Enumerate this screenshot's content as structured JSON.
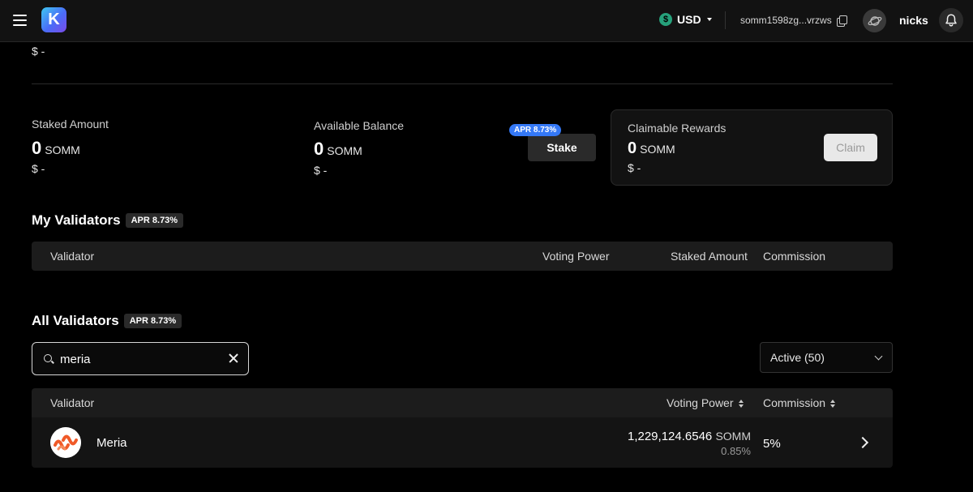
{
  "header": {
    "logo_letter": "K",
    "currency_symbol": "$",
    "currency": "USD",
    "wallet_address": "somm1598zg...vrzws",
    "username": "nicks"
  },
  "summary": {
    "top_usd": "$ -"
  },
  "staked": {
    "label": "Staked Amount",
    "amount": "0",
    "unit": "SOMM",
    "usd": "$ -"
  },
  "available": {
    "label": "Available Balance",
    "amount": "0",
    "unit": "SOMM",
    "usd": "$ -"
  },
  "stake_button": {
    "label": "Stake",
    "apr_badge": "APR 8.73%"
  },
  "rewards": {
    "label": "Claimable Rewards",
    "amount": "0",
    "unit": "SOMM",
    "usd": "$ -",
    "claim_label": "Claim"
  },
  "my_validators": {
    "title": "My Validators",
    "apr": "APR 8.73%",
    "columns": [
      "Validator",
      "Voting Power",
      "Staked Amount",
      "Commission"
    ]
  },
  "all_validators": {
    "title": "All Validators",
    "apr": "APR 8.73%",
    "search_value": "meria",
    "filter": "Active (50)",
    "columns": [
      "Validator",
      "Voting Power",
      "Commission"
    ],
    "rows": [
      {
        "name": "Meria",
        "voting_power": "1,229,124.6546",
        "voting_unit": "SOMM",
        "voting_pct": "0.85%",
        "commission": "5%"
      }
    ]
  },
  "colors": {
    "accent_blue": "#3478f6",
    "usd_green": "#26a17b",
    "meria_orange": "#f05a28"
  }
}
